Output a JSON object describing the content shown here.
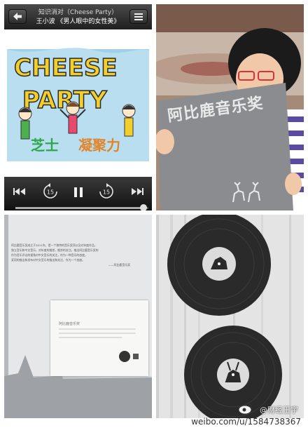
{
  "player": {
    "title": "知识消对（Cheese Party）",
    "subtitle": "王小波 《男人眼中的女性美》",
    "back_icon": "back-arrow-icon",
    "list_icon": "track-list-icon",
    "album_title": "CHEESE PARTY",
    "album_subtitle_left": "芝士",
    "album_subtitle_right": "凝聚力",
    "rewind15_label": "15",
    "forward15_label": "15"
  },
  "photo": {
    "award_text": "阿比鹿音乐奖"
  },
  "booklet": {
    "text_lines": [
      "阿比鹿音乐奖成立于2011年，是一个独特的音乐奖项以及对年度作品，",
      "独立音乐和中文音乐，对年度的推崇，推崇的关注，推出阿比鹿音乐奖的",
      "作为音乐评论的视角对中文音乐的关注，作为一种音乐的态度，",
      "奖项的推出和发布对中文音乐的推出和关注，作为一个态度。"
    ],
    "signature": "——阿比鹿音乐奖",
    "card_lines": [
      "阿比鹿音乐奖"
    ]
  },
  "footer": {
    "handle": "@财经王宇",
    "url": "weibo.com/u/1584738367"
  },
  "colors": {
    "player_bg": "#1d1d1d",
    "album_yellow": "#f2cf2a",
    "award_gray": "#8a8c8f",
    "vinyl_black": "#2a2a2a"
  }
}
